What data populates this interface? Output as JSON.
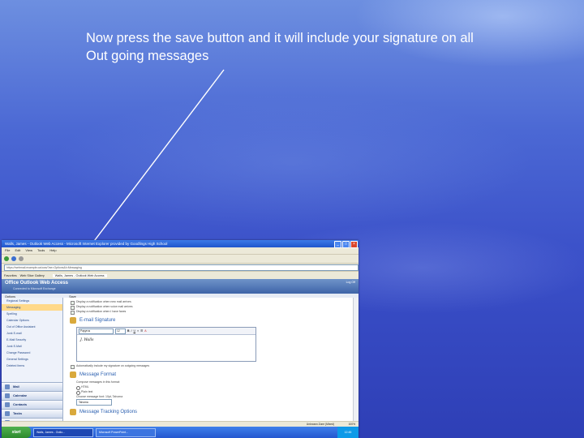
{
  "caption": {
    "line1": "Now press the save button and it will include your signature on all",
    "line2": "Out going messages"
  },
  "window": {
    "title": "Walls, James - Outlook Web Access - Microsoft Internet Explorer provided by Goodlings High School",
    "menu": [
      "File",
      "Edit",
      "View",
      "Tools",
      "Help"
    ],
    "address": "https://webmail.example.ca/owa/?ae=Options&t=Messaging",
    "favorites": [
      "Favorites",
      "Web Slice Gallery"
    ],
    "tab_title": "Walls, James - Outlook Web Access",
    "owa_title": "Office Outlook Web Access",
    "owa_subtitle": "Connected to Microsoft Exchange",
    "log_off": "Log Off",
    "toolbar_options": "Options",
    "save_label": "Save",
    "nav": [
      "Regional Settings",
      "Messaging",
      "Spelling",
      "Calendar Options",
      "Out of Office Assistant",
      "Junk E-mail",
      "E-Mail Security",
      "Junk E-Mail",
      "Change Password",
      "General Settings",
      "Deleted Items"
    ],
    "nav_buttons": [
      "Mail",
      "Calendar",
      "Contacts",
      "Tasks",
      "Documents"
    ],
    "checks": [
      "Display a notification when new mail arrives",
      "Display a notification when voice mail arrives",
      "Display a notification when I have faxes"
    ],
    "signature_heading": "E-mail Signature",
    "font_name": "Papyrus",
    "font_size": "12",
    "signature_text": "J. Walls",
    "auto_include": "Automatically include my signature on outgoing messages",
    "format_heading": "Message Format",
    "compose_label": "Compose messages in this format:",
    "format_options": [
      "HTML",
      "Plain text"
    ],
    "font_label": "Choose message font: 10pt, Tahoma",
    "font_choice": "Tahoma",
    "tracking_heading": "Message Tracking Options",
    "status_zone": "Unknown Zone (Mixed)",
    "zoom": "100%",
    "start": "start",
    "tasks": [
      "Walls, James - Outlo...",
      "Microsoft PowerPoint..."
    ],
    "clock": "12:45"
  }
}
